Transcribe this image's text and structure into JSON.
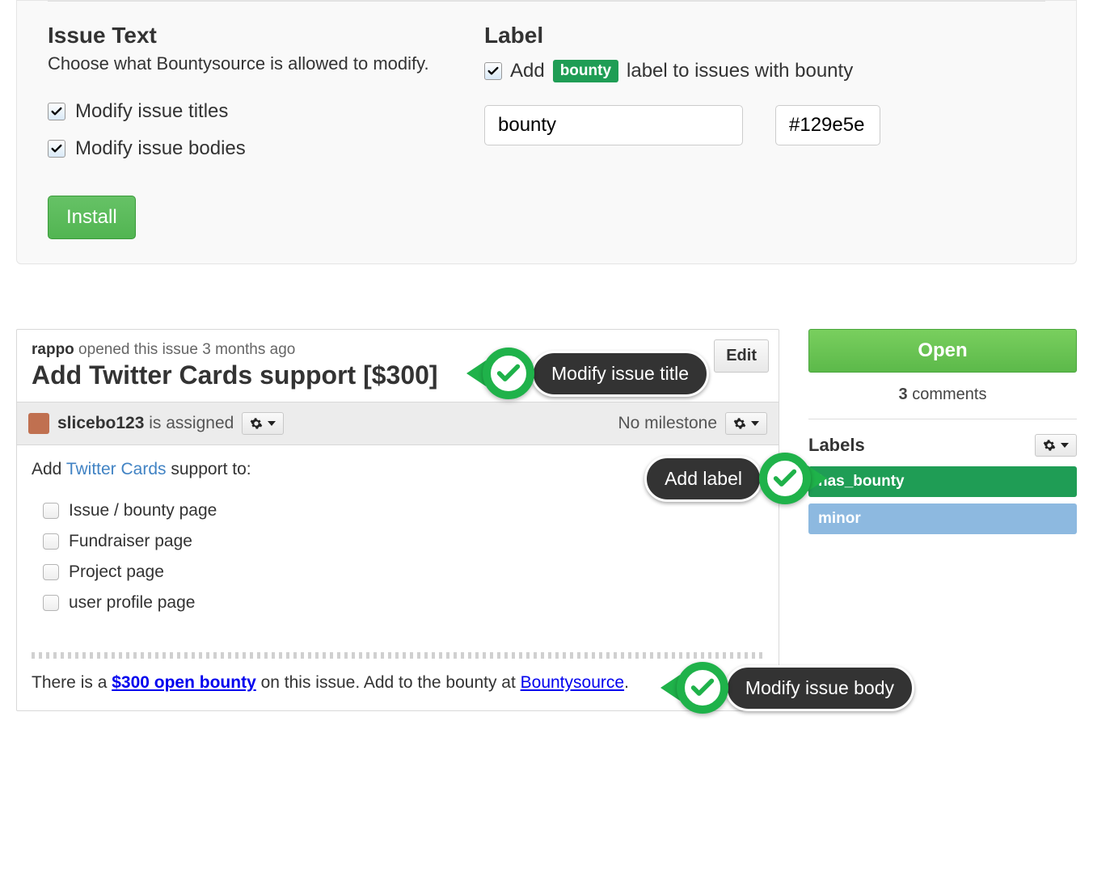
{
  "panel": {
    "issueText": {
      "heading": "Issue Text",
      "desc": "Choose what Bountysource is allowed to modify.",
      "chk1": "Modify issue titles",
      "chk2": "Modify issue bodies"
    },
    "label": {
      "heading": "Label",
      "add_prefix": "Add",
      "badge": "bounty",
      "add_suffix": "label to issues with bounty",
      "name_value": "bounty",
      "color_value": "#129e5e"
    },
    "install": "Install"
  },
  "issue": {
    "opened_user": "rappo",
    "opened_rest": " opened this issue 3 months ago",
    "title": "Add Twitter Cards support [$300]",
    "edit": "Edit",
    "assignee": "slicebo123",
    "assigned_text": " is assigned",
    "no_milestone": "No milestone",
    "body_prefix": "Add ",
    "body_link": "Twitter Cards",
    "body_suffix": " support to:",
    "todos": [
      "Issue / bounty page",
      "Fundraiser page",
      "Project page",
      "user profile page"
    ],
    "footer_prefix": "There is a ",
    "footer_bounty": "$300 open bounty",
    "footer_mid": " on this issue. Add to the bounty at ",
    "footer_link": "Bountysource",
    "footer_end": "."
  },
  "sidebar": {
    "open": "Open",
    "comments_n": "3",
    "comments_t": " comments",
    "labels_heading": "Labels",
    "labels": {
      "has": "has_bounty",
      "minor": "minor"
    }
  },
  "callouts": {
    "title": "Modify issue title",
    "label": "Add label",
    "body": "Modify issue body"
  }
}
